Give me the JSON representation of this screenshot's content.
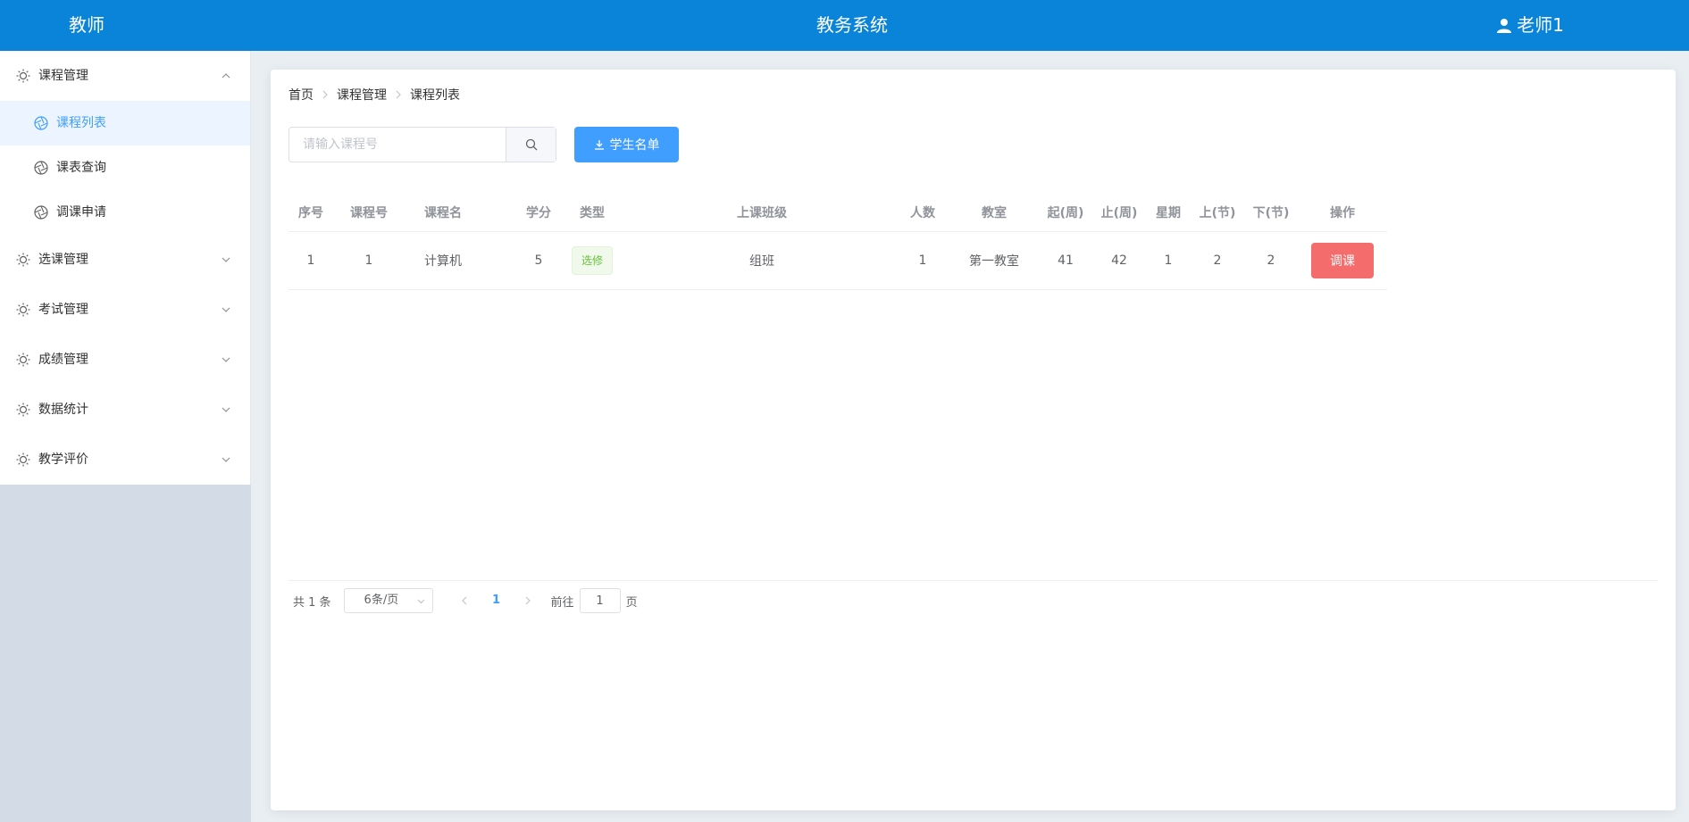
{
  "header": {
    "role": "教师",
    "system_title": "教务系统",
    "user_name": "老师1",
    "bg_color": "#0a84d9"
  },
  "sidebar": {
    "groups": [
      {
        "label": "课程管理",
        "expanded": true,
        "items": [
          {
            "label": "课程列表",
            "active": true
          },
          {
            "label": "课表查询",
            "active": false
          },
          {
            "label": "调课申请",
            "active": false
          }
        ]
      },
      {
        "label": "选课管理",
        "expanded": false
      },
      {
        "label": "考试管理",
        "expanded": false
      },
      {
        "label": "成绩管理",
        "expanded": false
      },
      {
        "label": "数据统计",
        "expanded": false
      },
      {
        "label": "教学评价",
        "expanded": false
      }
    ]
  },
  "breadcrumb": [
    "首页",
    "课程管理",
    "课程列表"
  ],
  "toolbar": {
    "search_placeholder": "请输入课程号",
    "student_list_button": "学生名单"
  },
  "table": {
    "headers": [
      "序号",
      "课程号",
      "课程名",
      "学分",
      "类型",
      "上课班级",
      "人数",
      "教室",
      "起(周)",
      "止(周)",
      "星期",
      "上(节)",
      "下(节)",
      "操作"
    ],
    "rows": [
      {
        "idx": "1",
        "code": "1",
        "name": "计算机",
        "credit": "5",
        "type": "选修",
        "class": "组班",
        "count": "1",
        "room": "第一教室",
        "start_week": "41",
        "end_week": "42",
        "weekday": "1",
        "start_section": "2",
        "end_section": "2",
        "action": "调课"
      }
    ]
  },
  "pagination": {
    "total": "共 1 条",
    "page_size": "6条/页",
    "current_page": "1",
    "goto_label": "前往",
    "goto_value": "1",
    "page_unit": "页"
  },
  "colors": {
    "primary": "#409eff",
    "danger": "#f56c6c",
    "success": "#67c23a"
  }
}
